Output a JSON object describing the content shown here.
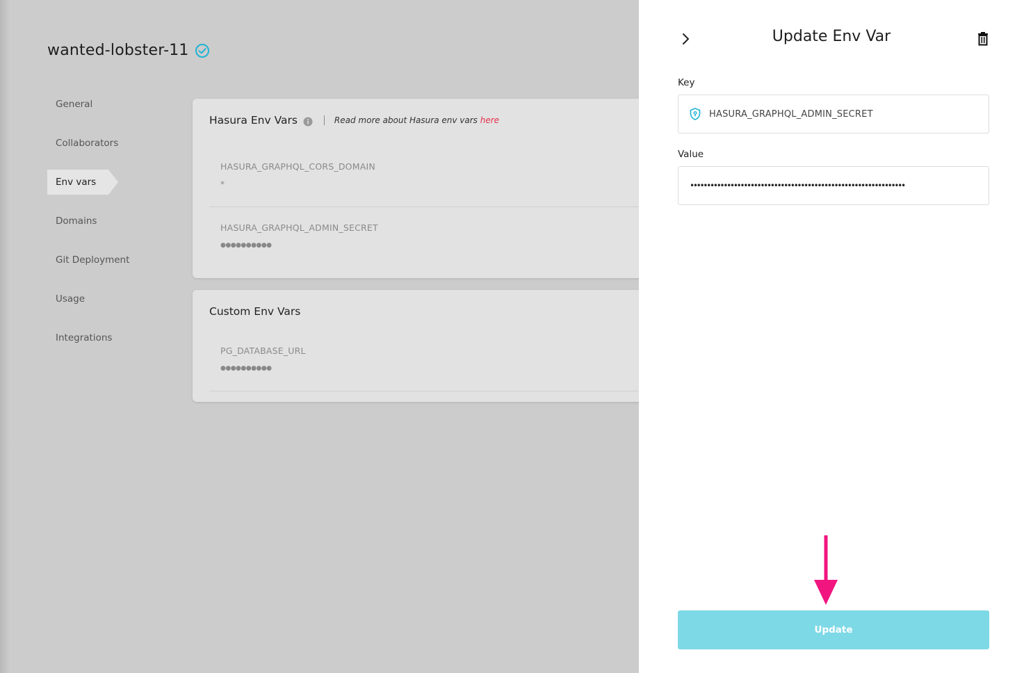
{
  "project": {
    "name": "wanted-lobster-11",
    "verified_icon": "check-circle-icon"
  },
  "sidebar": {
    "items": [
      {
        "label": "General"
      },
      {
        "label": "Collaborators"
      },
      {
        "label": "Env vars",
        "active": true
      },
      {
        "label": "Domains"
      },
      {
        "label": "Git Deployment"
      },
      {
        "label": "Usage"
      },
      {
        "label": "Integrations"
      }
    ]
  },
  "hasura_card": {
    "title": "Hasura Env Vars",
    "read_more_text": "Read more about Hasura env vars",
    "read_more_link": "here",
    "vars": [
      {
        "key": "HASURA_GRAPHQL_CORS_DOMAIN",
        "value": "*"
      },
      {
        "key": "HASURA_GRAPHQL_ADMIN_SECRET",
        "value": "●●●●●●●●●●"
      }
    ]
  },
  "custom_card": {
    "title": "Custom Env Vars",
    "vars": [
      {
        "key": "PG_DATABASE_URL",
        "value": "●●●●●●●●●●"
      }
    ]
  },
  "panel": {
    "title": "Update Env Var",
    "key_label": "Key",
    "key_value": "HASURA_GRAPHQL_ADMIN_SECRET",
    "value_label": "Value",
    "value_masked": "••••••••••••••••••••••••••••••••••••••••••••••••••••••••••••••••",
    "update_label": "Update"
  },
  "colors": {
    "accent": "#1eb4d4",
    "button": "#7ed9e6",
    "link": "#e8304e",
    "annotation_arrow": "#f0157f"
  }
}
